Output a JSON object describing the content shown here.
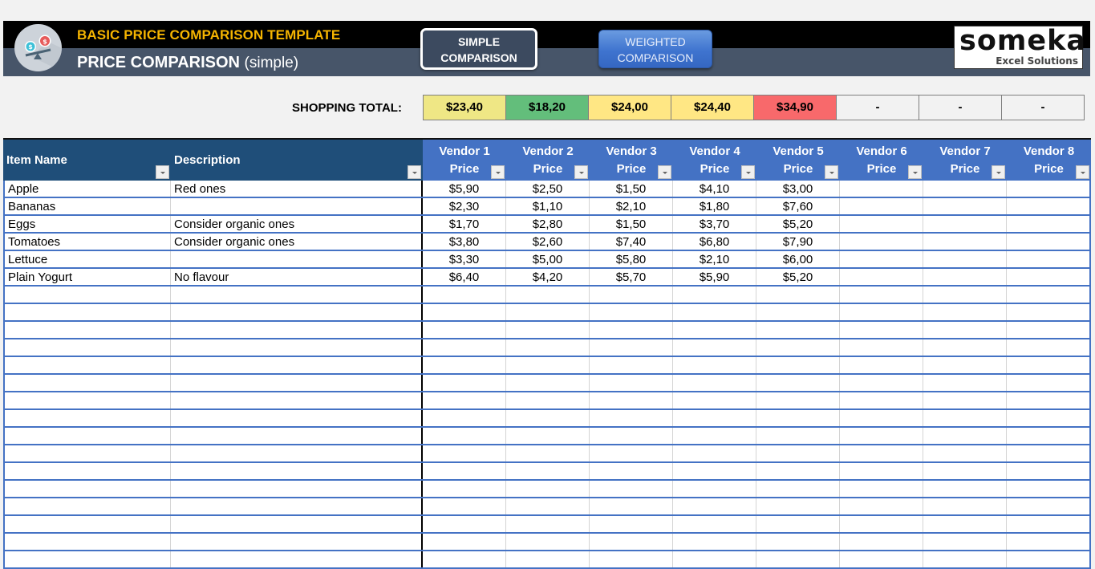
{
  "header": {
    "template_title": "BASIC PRICE COMPARISON TEMPLATE",
    "page_title": "PRICE COMPARISON",
    "page_subtitle": "(simple)",
    "logo_icon": "balance-scale-dollar-icon",
    "nav": [
      {
        "label_line1": "SIMPLE",
        "label_line2": "COMPARISON",
        "active": true
      },
      {
        "label_line1": "WEIGHTED",
        "label_line2": "COMPARISON",
        "active": false
      }
    ],
    "brand": {
      "name": "someka",
      "tagline": "Excel Solutions"
    }
  },
  "shopping_total": {
    "label": "SHOPPING TOTAL:",
    "values": [
      {
        "value": "$23,40",
        "color": "#efe785"
      },
      {
        "value": "$18,20",
        "color": "#63be7b"
      },
      {
        "value": "$24,00",
        "color": "#ffe784"
      },
      {
        "value": "$24,40",
        "color": "#ffe784"
      },
      {
        "value": "$34,90",
        "color": "#f8696b"
      },
      {
        "value": "-",
        "color": "#f2f2f2"
      },
      {
        "value": "-",
        "color": "#f2f2f2"
      },
      {
        "value": "-",
        "color": "#f2f2f2"
      }
    ]
  },
  "table": {
    "columns": {
      "item_name": "Item Name",
      "description": "Description",
      "vendors": [
        {
          "name": "Vendor 1",
          "sub": "Price"
        },
        {
          "name": "Vendor 2",
          "sub": "Price"
        },
        {
          "name": "Vendor 3",
          "sub": "Price"
        },
        {
          "name": "Vendor 4",
          "sub": "Price"
        },
        {
          "name": "Vendor 5",
          "sub": "Price"
        },
        {
          "name": "Vendor 6",
          "sub": "Price"
        },
        {
          "name": "Vendor 7",
          "sub": "Price"
        },
        {
          "name": "Vendor 8",
          "sub": "Price"
        }
      ]
    },
    "rows": [
      {
        "item": "Apple",
        "description": "Red ones",
        "prices": [
          "$5,90",
          "$2,50",
          "$1,50",
          "$4,10",
          "$3,00",
          "",
          "",
          ""
        ]
      },
      {
        "item": "Bananas",
        "description": "",
        "prices": [
          "$2,30",
          "$1,10",
          "$2,10",
          "$1,80",
          "$7,60",
          "",
          "",
          ""
        ]
      },
      {
        "item": "Eggs",
        "description": "Consider organic ones",
        "prices": [
          "$1,70",
          "$2,80",
          "$1,50",
          "$3,70",
          "$5,20",
          "",
          "",
          ""
        ]
      },
      {
        "item": "Tomatoes",
        "description": "Consider organic ones",
        "prices": [
          "$3,80",
          "$2,60",
          "$7,40",
          "$6,80",
          "$7,90",
          "",
          "",
          ""
        ]
      },
      {
        "item": "Lettuce",
        "description": "",
        "prices": [
          "$3,30",
          "$5,00",
          "$5,80",
          "$2,10",
          "$6,00",
          "",
          "",
          ""
        ]
      },
      {
        "item": "Plain Yogurt",
        "description": "No flavour",
        "prices": [
          "$6,40",
          "$4,20",
          "$5,70",
          "$5,90",
          "$5,20",
          "",
          "",
          ""
        ]
      }
    ],
    "empty_rows": 16
  }
}
